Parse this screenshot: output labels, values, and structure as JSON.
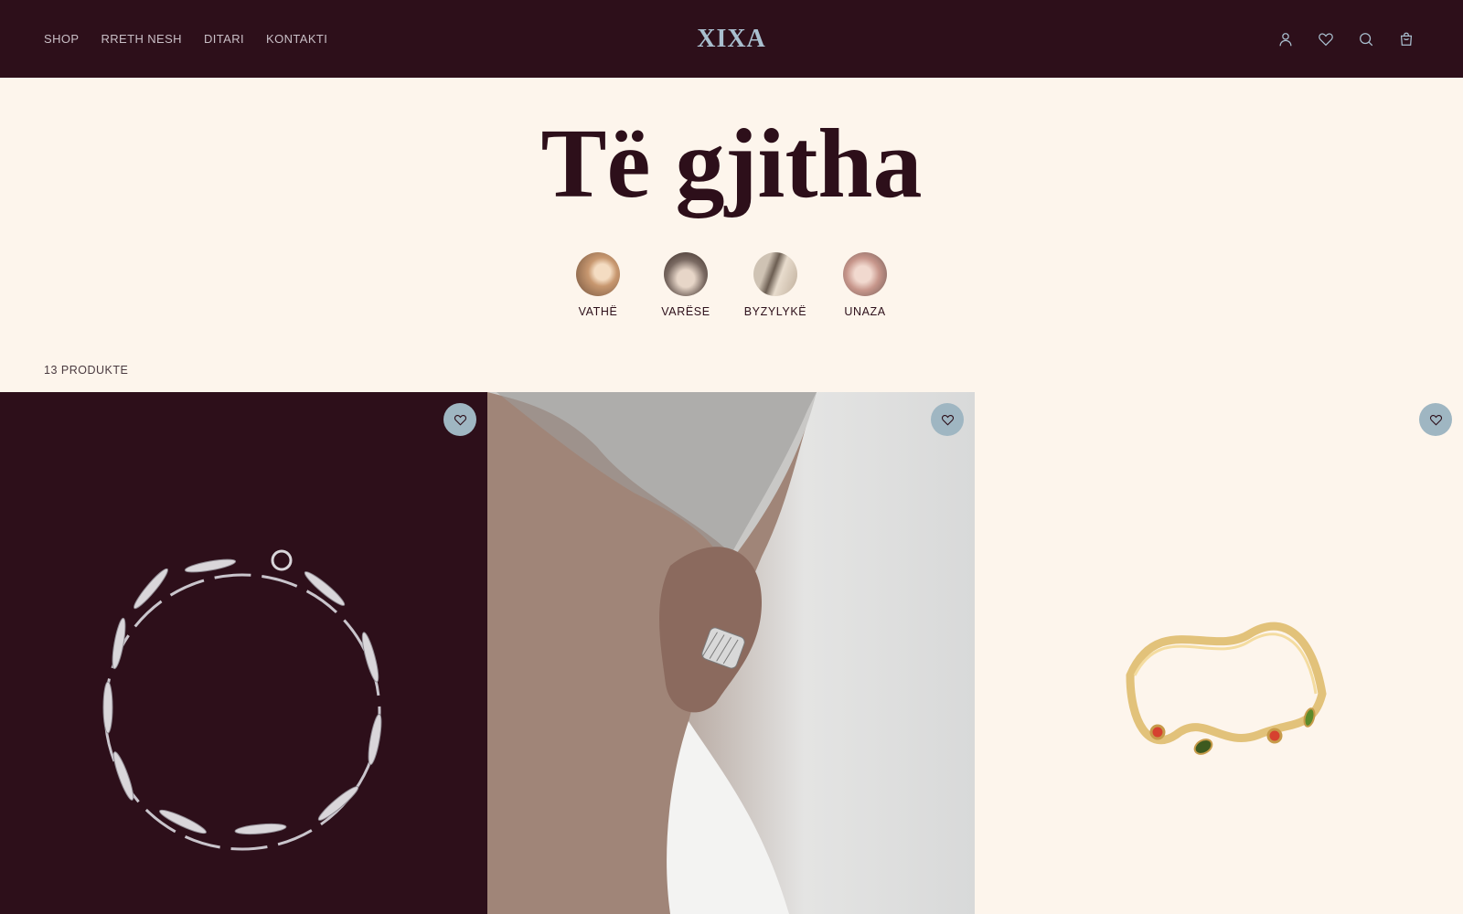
{
  "header": {
    "nav": [
      "SHOP",
      "RRETH NESH",
      "DITARI",
      "KONTAKTI"
    ],
    "logo": "XIXA",
    "icons": [
      "user-icon",
      "heart-icon",
      "search-icon",
      "cart-icon"
    ]
  },
  "page": {
    "title": "Të gjitha",
    "categories": [
      {
        "label": "VATHË"
      },
      {
        "label": "VARËSE"
      },
      {
        "label": "BYZYLYKË"
      },
      {
        "label": "UNAZA"
      }
    ],
    "product_count": "13 PRODUKTE"
  },
  "products": [
    {
      "image": "silver-bracelet",
      "wishlist_icon": "heart-icon"
    },
    {
      "image": "ear-cuff-model",
      "wishlist_icon": "heart-icon"
    },
    {
      "image": "gold-wave-ring",
      "wishlist_icon": "heart-icon"
    }
  ],
  "colors": {
    "brand_dark": "#2d0f1a",
    "background": "#fdf5ec",
    "accent": "#a9bfcf",
    "wishlist_button": "#9fb6c2"
  }
}
